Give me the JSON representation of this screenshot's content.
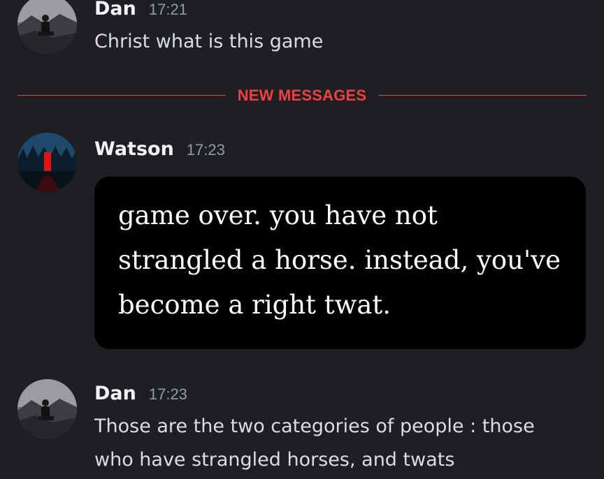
{
  "messages": [
    {
      "author": "Dan",
      "time": "17:21",
      "avatar_icon": "user-avatar-icon",
      "lines": [
        "Christ what is this game"
      ]
    },
    {
      "author": "Watson",
      "time": "17:23",
      "avatar_icon": "user-avatar-icon",
      "image_text_lines": [
        "game over. you have not",
        "strangled a horse. instead, you've",
        "become a right twat."
      ]
    },
    {
      "author": "Dan",
      "time": "17:23",
      "avatar_icon": "user-avatar-icon",
      "lines": [
        "Those are the two categories of people : those",
        "who have strangled horses, and twats"
      ]
    }
  ],
  "divider": {
    "label": "NEW MESSAGES",
    "color": "#f23f43"
  },
  "colors": {
    "background": "#1e1f22",
    "username": "#f2f3f5",
    "timestamp": "#949ba4",
    "message_text": "#dbdee1",
    "image_background": "#000000"
  }
}
